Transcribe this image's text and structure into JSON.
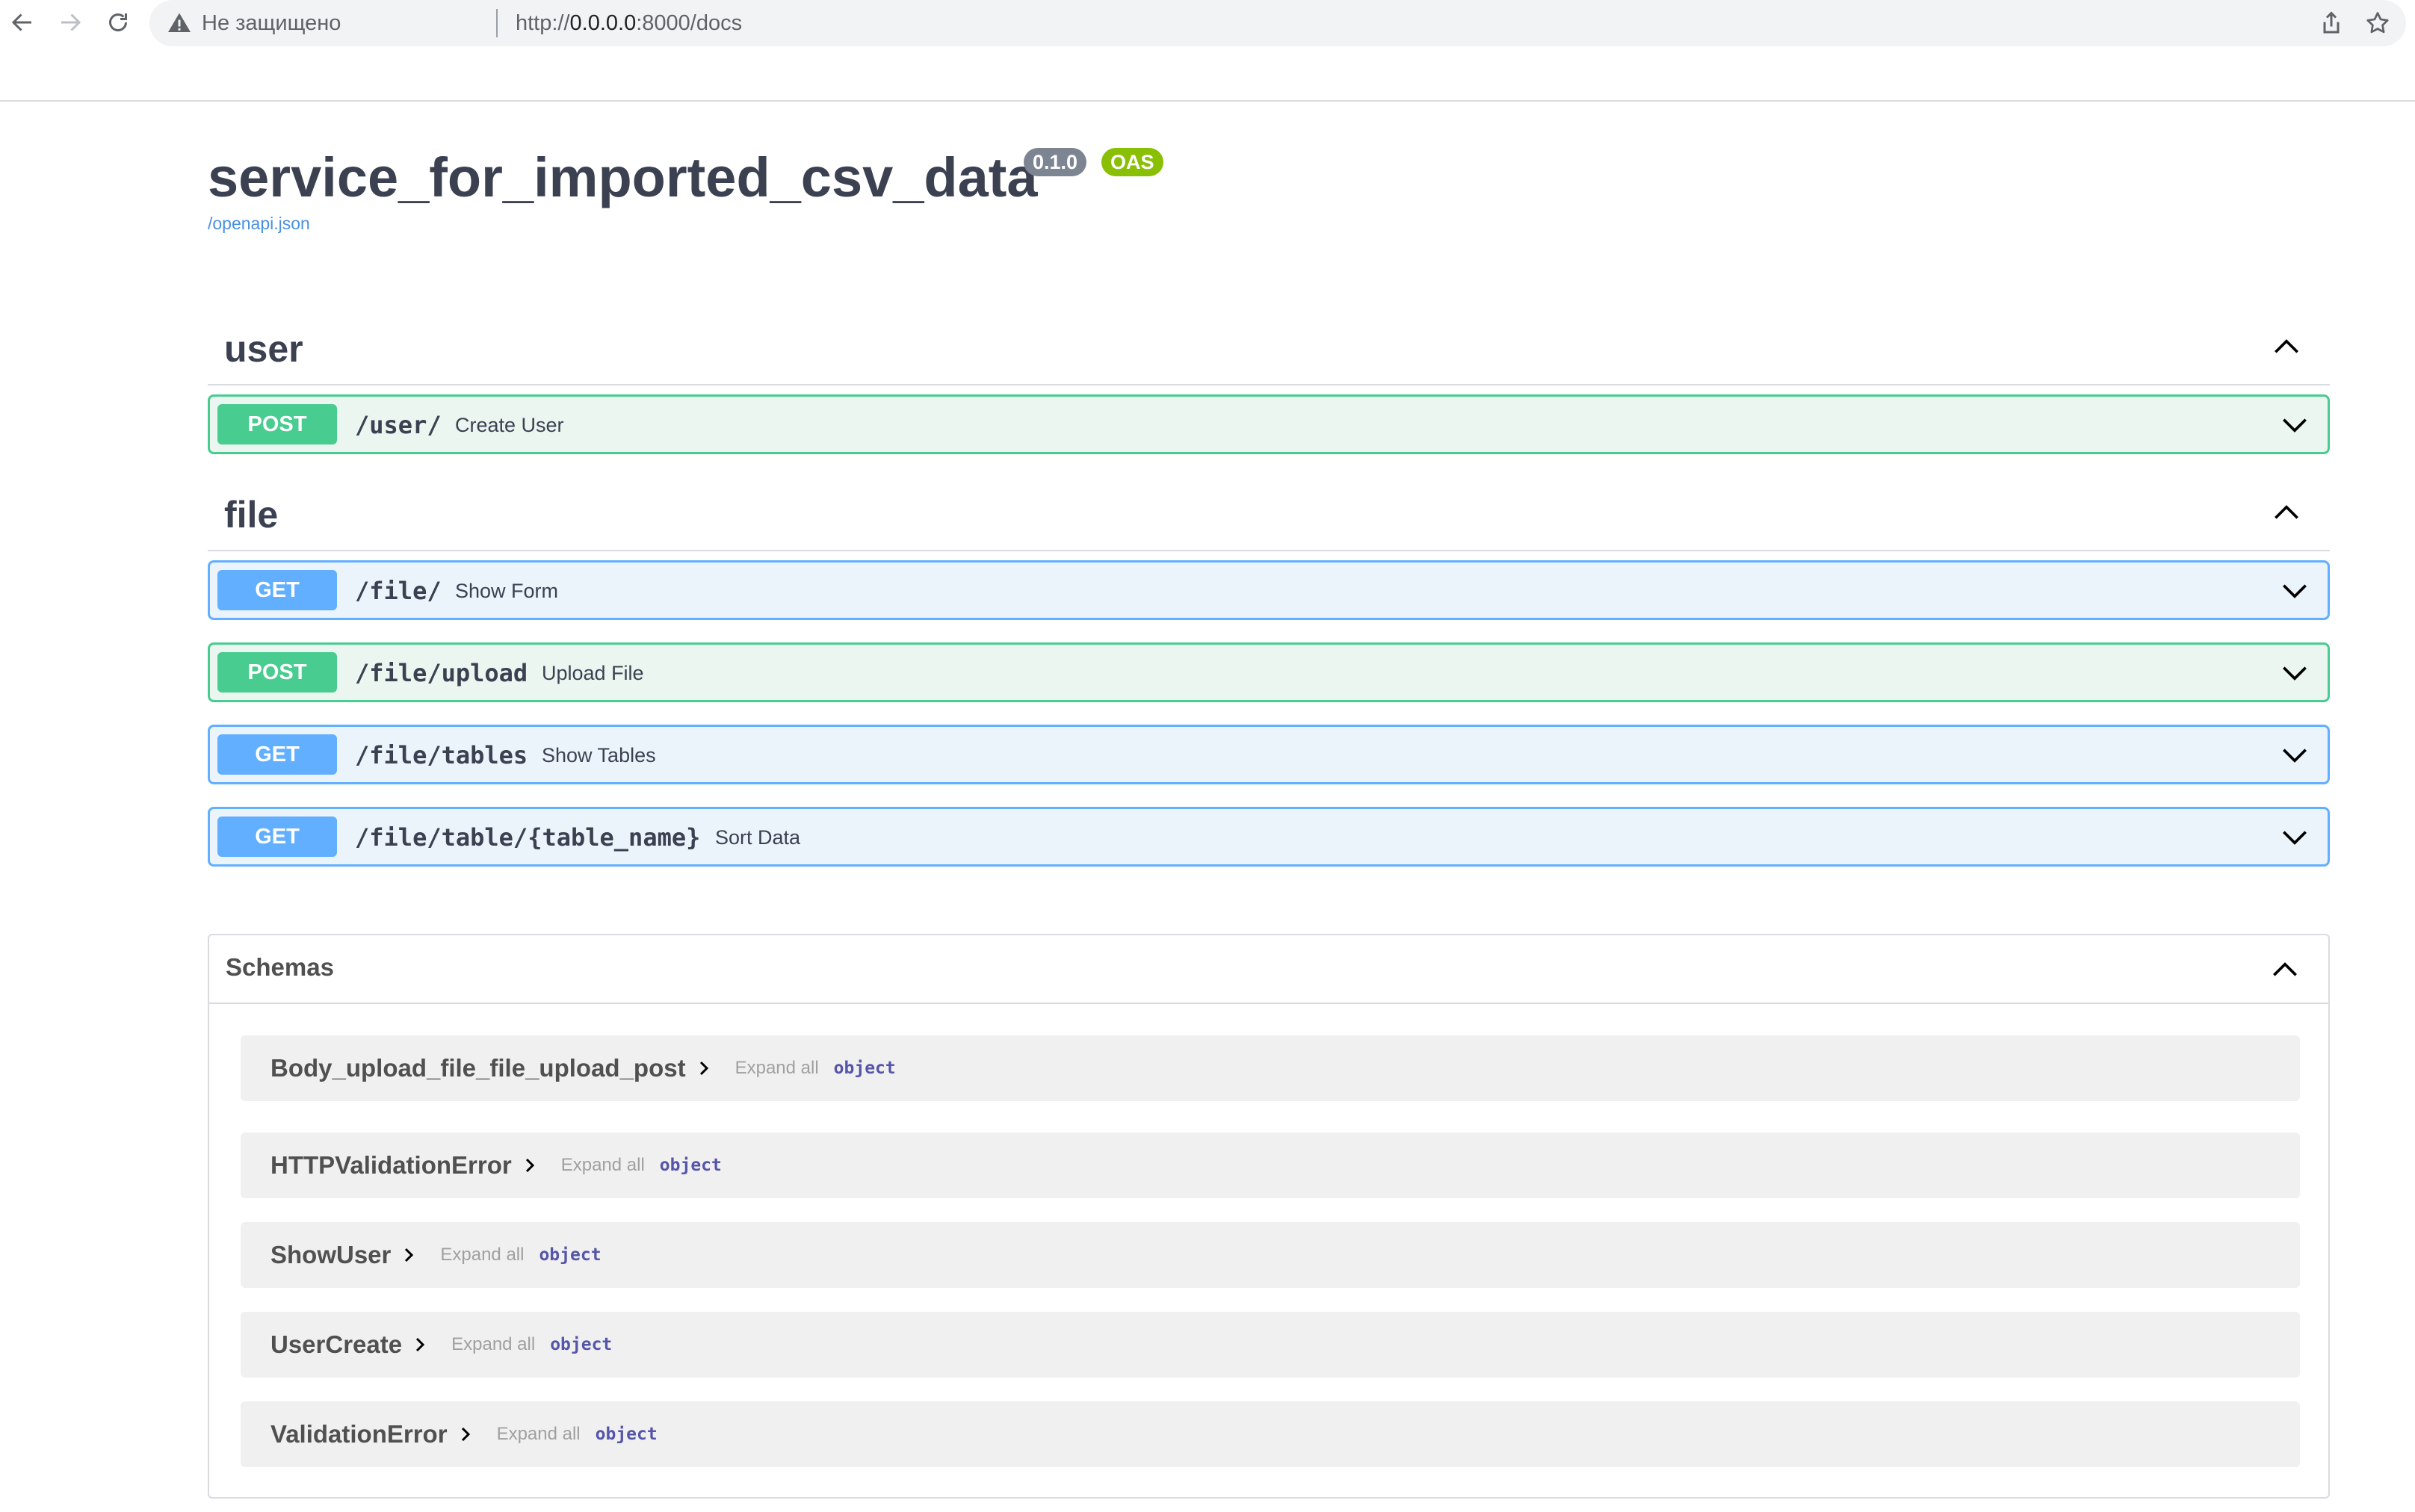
{
  "browser": {
    "security_status": "Не защищено",
    "url_scheme": "http://",
    "url_host": "0.0.0.0",
    "url_rest": ":8000/docs"
  },
  "info": {
    "title": "service_for_imported_csv_data",
    "version": "0.1.0",
    "oas": "OAS 3.1",
    "spec_link": "/openapi.json"
  },
  "tags": [
    {
      "name": "user",
      "operations": [
        {
          "method": "POST",
          "path": "/user/",
          "summary": "Create User"
        }
      ]
    },
    {
      "name": "file",
      "operations": [
        {
          "method": "GET",
          "path": "/file/",
          "summary": "Show Form"
        },
        {
          "method": "POST",
          "path": "/file/upload",
          "summary": "Upload File"
        },
        {
          "method": "GET",
          "path": "/file/tables",
          "summary": "Show Tables"
        },
        {
          "method": "GET",
          "path": "/file/table/{table_name}",
          "summary": "Sort Data"
        }
      ]
    }
  ],
  "schemas": {
    "title": "Schemas",
    "items": [
      {
        "name": "Body_upload_file_file_upload_post",
        "expand": "Expand all",
        "type": "object"
      },
      {
        "name": "HTTPValidationError",
        "expand": "Expand all",
        "type": "object"
      },
      {
        "name": "ShowUser",
        "expand": "Expand all",
        "type": "object"
      },
      {
        "name": "UserCreate",
        "expand": "Expand all",
        "type": "object"
      },
      {
        "name": "ValidationError",
        "expand": "Expand all",
        "type": "object"
      }
    ]
  },
  "colors": {
    "post": "#49cc90",
    "get": "#61affe",
    "version_badge": "#7d8492",
    "oas_badge": "#89bf04",
    "link": "#4990e2"
  }
}
